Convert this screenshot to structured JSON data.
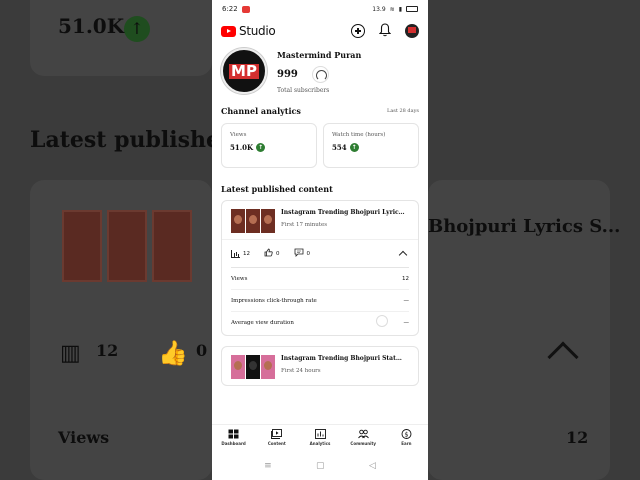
{
  "background": {
    "top_value": "51.0K",
    "heading": "Latest published",
    "video_title_fragment": "Bhojpuri Lyrics S...",
    "views_count": "12",
    "likes_count": "0",
    "views_label": "Views",
    "views_value": "12"
  },
  "status_bar": {
    "time": "6:22",
    "right_text": "13.9"
  },
  "app_bar": {
    "title": "Studio"
  },
  "channel": {
    "name": "Mastermind Puran",
    "subscribers": "999",
    "subscribers_label": "Total subscribers",
    "avatar_text": "MP"
  },
  "analytics": {
    "title": "Channel analytics",
    "period_link": "Last 28 days",
    "metrics": [
      {
        "label": "Views",
        "value": "51.0K"
      },
      {
        "label": "Watch time (hours)",
        "value": "554"
      }
    ]
  },
  "latest": {
    "title": "Latest published content",
    "videos": [
      {
        "title": "Instagram Trending Bhojpuri Lyrics S...",
        "time": "First 17 minutes",
        "views": "12",
        "likes": "0",
        "comments": "0",
        "rows": [
          {
            "label": "Views",
            "value": "12"
          },
          {
            "label": "Impressions click-through rate",
            "value": "—"
          },
          {
            "label": "Average view duration",
            "value": "—"
          }
        ]
      },
      {
        "title": "Instagram Trending Bhojpuri Status V...",
        "time": "First 24 hours"
      }
    ]
  },
  "bottom_nav": [
    {
      "label": "Dashboard"
    },
    {
      "label": "Content"
    },
    {
      "label": "Analytics"
    },
    {
      "label": "Community"
    },
    {
      "label": "Earn"
    }
  ],
  "colors": {
    "accent_red": "#ff0000",
    "positive_green": "#2e7d32"
  }
}
